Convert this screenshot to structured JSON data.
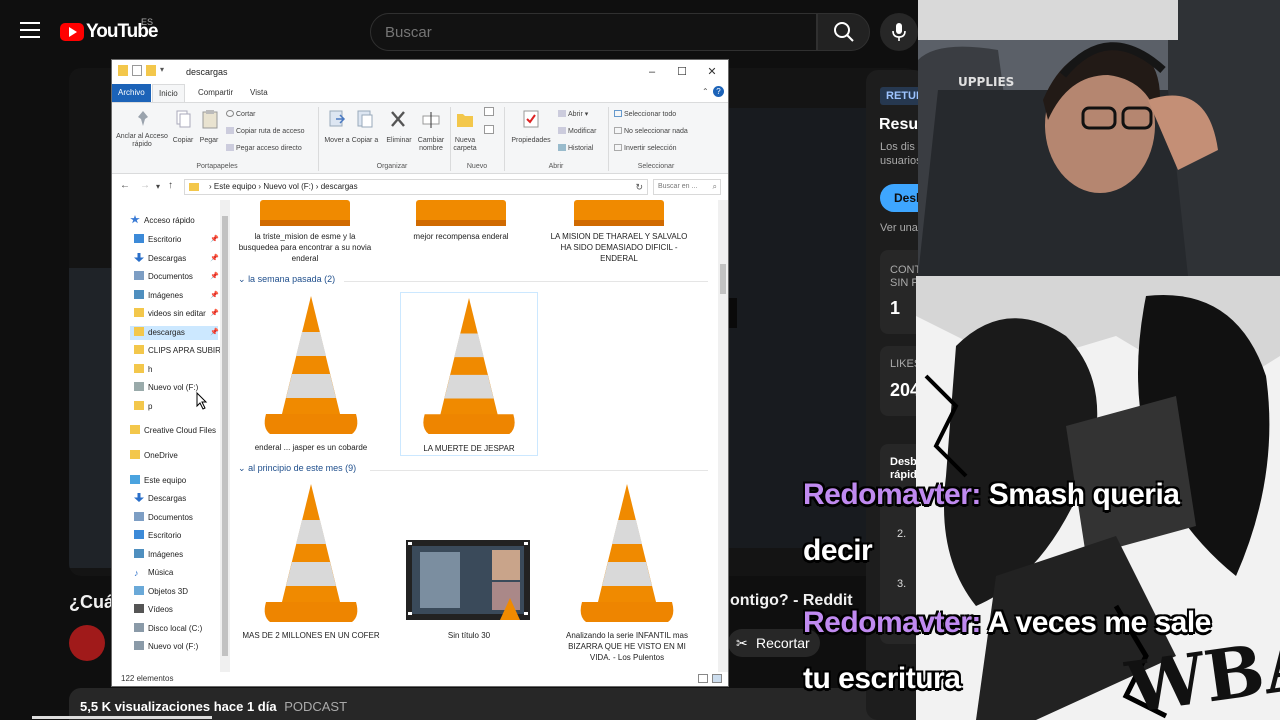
{
  "youtube": {
    "logo_text": "YouTube",
    "country": "ES",
    "search_placeholder": "Buscar",
    "video_title_left": "¿Cuál",
    "video_title_right": "ontigo? - Reddit",
    "recortar_label": "Recortar",
    "views": "5,5 K visualizaciones",
    "time_ago": "hace 1 día",
    "tag": "PODCAST"
  },
  "right_panel": {
    "badge": "RETUR",
    "title": "Resur",
    "subtitle_1": "Los dis",
    "subtitle_2": "usuarios",
    "button": "Desb",
    "link": "Ver una",
    "card1_label_1": "CONT",
    "card1_label_2": "SIN P",
    "card1_value": "1",
    "card2_label": "LIKES",
    "card2_value": "204",
    "card3_label_1": "Desb",
    "card3_label_2": "rápid",
    "list_2": "2.",
    "list_3": "3."
  },
  "chat": [
    {
      "user": "Redomavter:",
      "text": "Smash queria"
    },
    {
      "user": "",
      "text": "decir"
    },
    {
      "user": "Redomavter:",
      "text": "A veces me sale"
    },
    {
      "user": "",
      "text": "tu escritura"
    }
  ],
  "explorer": {
    "title": "descargas",
    "window_controls": {
      "minimize": "–",
      "maximize": "☐",
      "close": "✕"
    },
    "tabs": [
      "Archivo",
      "Inicio",
      "Compartir",
      "Vista"
    ],
    "help": "?",
    "ribbon": {
      "pin": "Anclar al Acceso rápido",
      "copy": "Copiar",
      "paste": "Pegar",
      "cut": "Cortar",
      "copy_path": "Copiar ruta de acceso",
      "paste_shortcut": "Pegar acceso directo",
      "group_clipboard": "Portapapeles",
      "move": "Mover a",
      "copy_to": "Copiar a",
      "delete": "Eliminar",
      "rename": "Cambiar nombre",
      "group_organize": "Organizar",
      "new_folder": "Nueva carpeta",
      "group_new": "Nuevo",
      "properties": "Propiedades",
      "open": "Abrir",
      "modify": "Modificar",
      "history": "Historial",
      "group_open": "Abrir",
      "select_all": "Seleccionar todo",
      "select_none": "No seleccionar nada",
      "invert": "Invertir selección",
      "group_select": "Seleccionar"
    },
    "breadcrumb": [
      "Este equipo",
      "Nuevo vol (F:)",
      "descargas"
    ],
    "search_placeholder": "Buscar en ...",
    "nav": {
      "quick_access": "Acceso rápido",
      "items": [
        "Escritorio",
        "Descargas",
        "Documentos",
        "Imágenes",
        "videos sin editar",
        "descargas",
        "CLIPS APRA SUBIR",
        "h",
        "Nuevo vol (F:)",
        "p"
      ],
      "creative": "Creative Cloud Files",
      "onedrive": "OneDrive",
      "this_pc": "Este equipo",
      "pc_items": [
        "Descargas",
        "Documentos",
        "Escritorio",
        "Imágenes",
        "Música",
        "Objetos 3D",
        "Vídeos",
        "Disco local (C:)",
        "Nuevo vol (F:)"
      ]
    },
    "files_top": [
      "la triste_mision de esme y la busquedea para encontrar a su novia enderal",
      "mejor recompensa enderal",
      "LA MISION DE THARAEL Y SALVALO HA SIDO DEMASIADO DIFICIL - ENDERAL"
    ],
    "group_last_week": "la semana pasada (2)",
    "files_last_week": [
      "enderal ... jasper es un cobarde",
      "LA MUERTE DE JESPAR"
    ],
    "group_month": "al principio de este mes (9)",
    "files_month": [
      "MAS DE 2 MILLONES EN UN COFER",
      "Sin título 30",
      "Analizando la serie INFANTIL mas BIZARRA QUE HE VISTO EN MI VIDA. - Los Pulentos"
    ],
    "status": "122 elementos"
  },
  "colors": {
    "accent": "#1c63b8",
    "chat_user": "#c08af0",
    "youtube_red": "#ff0000",
    "vlc_orange": "#f08a00"
  }
}
